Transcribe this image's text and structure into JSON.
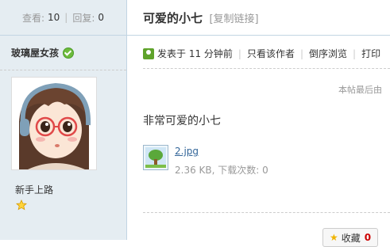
{
  "sidebar": {
    "views_label": "查看:",
    "views_count": "10",
    "replies_label": "回复:",
    "replies_count": "0",
    "author_name": "玻璃屋女孩",
    "rank": "新手上路"
  },
  "thread": {
    "title": "可爱的小七",
    "copy_link": "[复制链接]"
  },
  "post_meta": {
    "posted": "发表于 11 分钟前",
    "only_author": "只看该作者",
    "reverse": "倒序浏览",
    "print": "打印"
  },
  "post": {
    "last_edit": "本帖最后由",
    "message": "非常可爱的小七",
    "attachment_name": "2.jpg",
    "attachment_info": "2.36 KB, 下载次数: 0"
  },
  "actions": {
    "favorite_label": "收藏",
    "favorite_count": "0"
  },
  "colors": {
    "sidebar_bg": "#e5edf2",
    "border": "#c2d5e3",
    "link": "#336699"
  }
}
